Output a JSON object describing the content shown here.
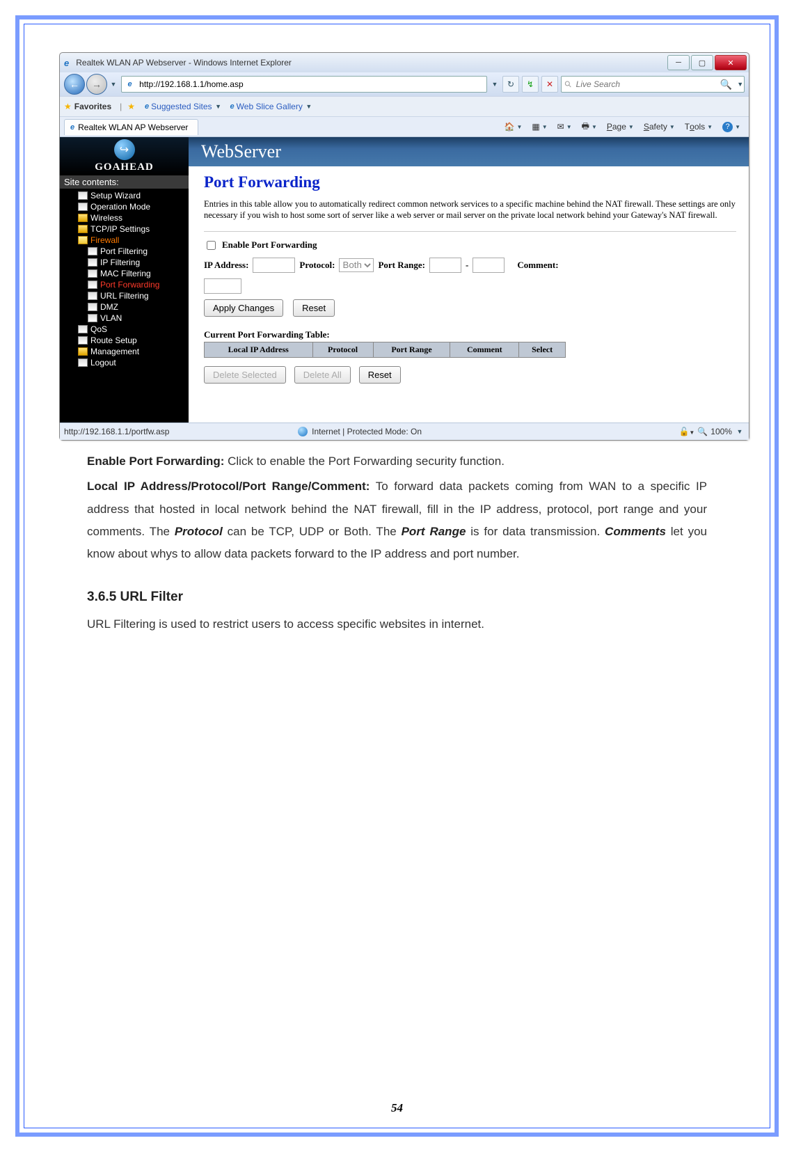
{
  "browser": {
    "title": "Realtek WLAN AP Webserver - Windows Internet Explorer",
    "url": "http://192.168.1.1/home.asp",
    "search_placeholder": "Live Search",
    "favorites_label": "Favorites",
    "suggested": "Suggested Sites",
    "gallery": "Web Slice Gallery",
    "tab_label": "Realtek WLAN AP Webserver",
    "tool_page": "Page",
    "tool_safety": "Safety",
    "tool_tools": "Tools",
    "status_url": "http://192.168.1.1/portfw.asp",
    "status_zone": "Internet | Protected Mode: On",
    "zoom": "100%"
  },
  "sidebar": {
    "brand": "GOAHEAD",
    "header": "Site contents:",
    "items": [
      "Setup Wizard",
      "Operation Mode",
      "Wireless",
      "TCP/IP Settings",
      "Firewall",
      "Port Filtering",
      "IP Filtering",
      "MAC Filtering",
      "Port Forwarding",
      "URL Filtering",
      "DMZ",
      "VLAN",
      "QoS",
      "Route Setup",
      "Management",
      "Logout"
    ]
  },
  "main": {
    "banner": "WebServer",
    "heading": "Port Forwarding",
    "desc": "Entries in this table allow you to automatically redirect common network services to a specific machine behind the NAT firewall. These settings are only necessary if you wish to host some sort of server like a web server or mail server on the private local network behind your Gateway's NAT firewall.",
    "enable_label": "Enable Port Forwarding",
    "ip_label": "IP Address:",
    "proto_label": "Protocol:",
    "proto_value": "Both",
    "range_label": "Port Range:",
    "range_sep": "-",
    "comment_label": "Comment:",
    "btn_apply": "Apply Changes",
    "btn_reset": "Reset",
    "table_title": "Current Port Forwarding Table:",
    "th": [
      "Local IP Address",
      "Protocol",
      "Port Range",
      "Comment",
      "Select"
    ],
    "btn_delsel": "Delete Selected",
    "btn_delall": "Delete All",
    "btn_reset2": "Reset"
  },
  "doc": {
    "p1_b": "Enable Port Forwarding:",
    "p1_t": " Click to enable the Port Forwarding security function.",
    "p2_b": "Local IP Address/Protocol/Port Range/Comment:",
    "p2_t1": " To forward data packets coming from WAN to a specific IP address that hosted in local network behind the NAT firewall, fill in the IP address, protocol, port range and your comments. The ",
    "p2_i1": "Protocol",
    "p2_t2": " can be TCP, UDP or Both. The ",
    "p2_i2": "Port Range",
    "p2_t3": " is for data transmission. ",
    "p2_i3": "Comments",
    "p2_t4": " let you know about whys to allow data packets forward to the IP address and port number.",
    "h3": "3.6.5 URL Filter",
    "p3": "URL Filtering is used to restrict users to access specific websites in internet.",
    "pagenum": "54"
  }
}
